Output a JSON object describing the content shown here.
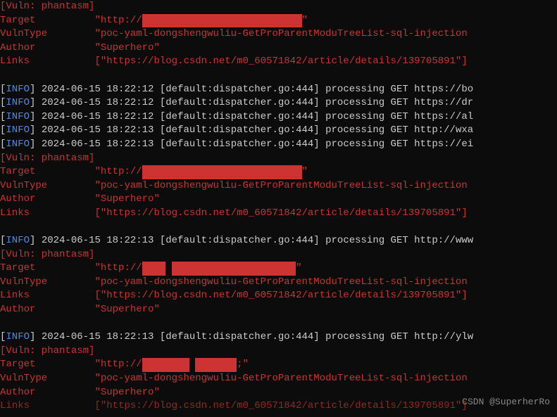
{
  "vuln_header": "[Vuln: phantasm]",
  "labels": {
    "target": "Target",
    "vulntype": "VulnType",
    "author": "Author",
    "links": "Links"
  },
  "blocks": [
    {
      "target_prefix": "\"http://",
      "target_suffix": "\"",
      "vulntype": "\"poc-yaml-dongshengwuliu-GetProParentModuTreeList-sql-injection",
      "author": "\"Superhero\"",
      "links": "[\"https://blog.csdn.net/m0_60571842/article/details/139705891\"]"
    },
    {
      "target_prefix": "\"http://",
      "target_suffix": "\"",
      "vulntype": "\"poc-yaml-dongshengwuliu-GetProParentModuTreeList-sql-injection",
      "author": "\"Superhero\"",
      "links": "[\"https://blog.csdn.net/m0_60571842/article/details/139705891\"]"
    },
    {
      "target_prefix": "\"http://",
      "target_suffix": "\"",
      "vulntype": "\"poc-yaml-dongshengwuliu-GetProParentModuTreeList-sql-injection",
      "author": "\"Superhero\"",
      "links": "[\"https://blog.csdn.net/m0_60571842/article/details/139705891\"]"
    },
    {
      "target_prefix": "\"http://",
      "target_suffix": ";\"",
      "vulntype": "\"poc-yaml-dongshengwuliu-GetProParentModuTreeList-sql-injection",
      "author": "\"Superhero\"",
      "links": "[\"https://blog.csdn.net/m0_60571842/article/details/139705891\"]"
    }
  ],
  "info_label": "INFO",
  "info_lines": [
    {
      "ts": "2024-06-15 18:22:12",
      "loc": "[default:dispatcher.go:444]",
      "msg": "processing GET https://bo"
    },
    {
      "ts": "2024-06-15 18:22:12",
      "loc": "[default:dispatcher.go:444]",
      "msg": "processing GET https://dr"
    },
    {
      "ts": "2024-06-15 18:22:12",
      "loc": "[default:dispatcher.go:444]",
      "msg": "processing GET https://al"
    },
    {
      "ts": "2024-06-15 18:22:13",
      "loc": "[default:dispatcher.go:444]",
      "msg": "processing GET http://wxa"
    },
    {
      "ts": "2024-06-15 18:22:13",
      "loc": "[default:dispatcher.go:444]",
      "msg": "processing GET https://ei"
    },
    {
      "ts": "2024-06-15 18:22:13",
      "loc": "[default:dispatcher.go:444]",
      "msg": "processing GET http://www"
    },
    {
      "ts": "2024-06-15 18:22:13",
      "loc": "[default:dispatcher.go:444]",
      "msg": "processing GET http://ylw"
    }
  ],
  "watermark": "CSDN @SuperherRo"
}
